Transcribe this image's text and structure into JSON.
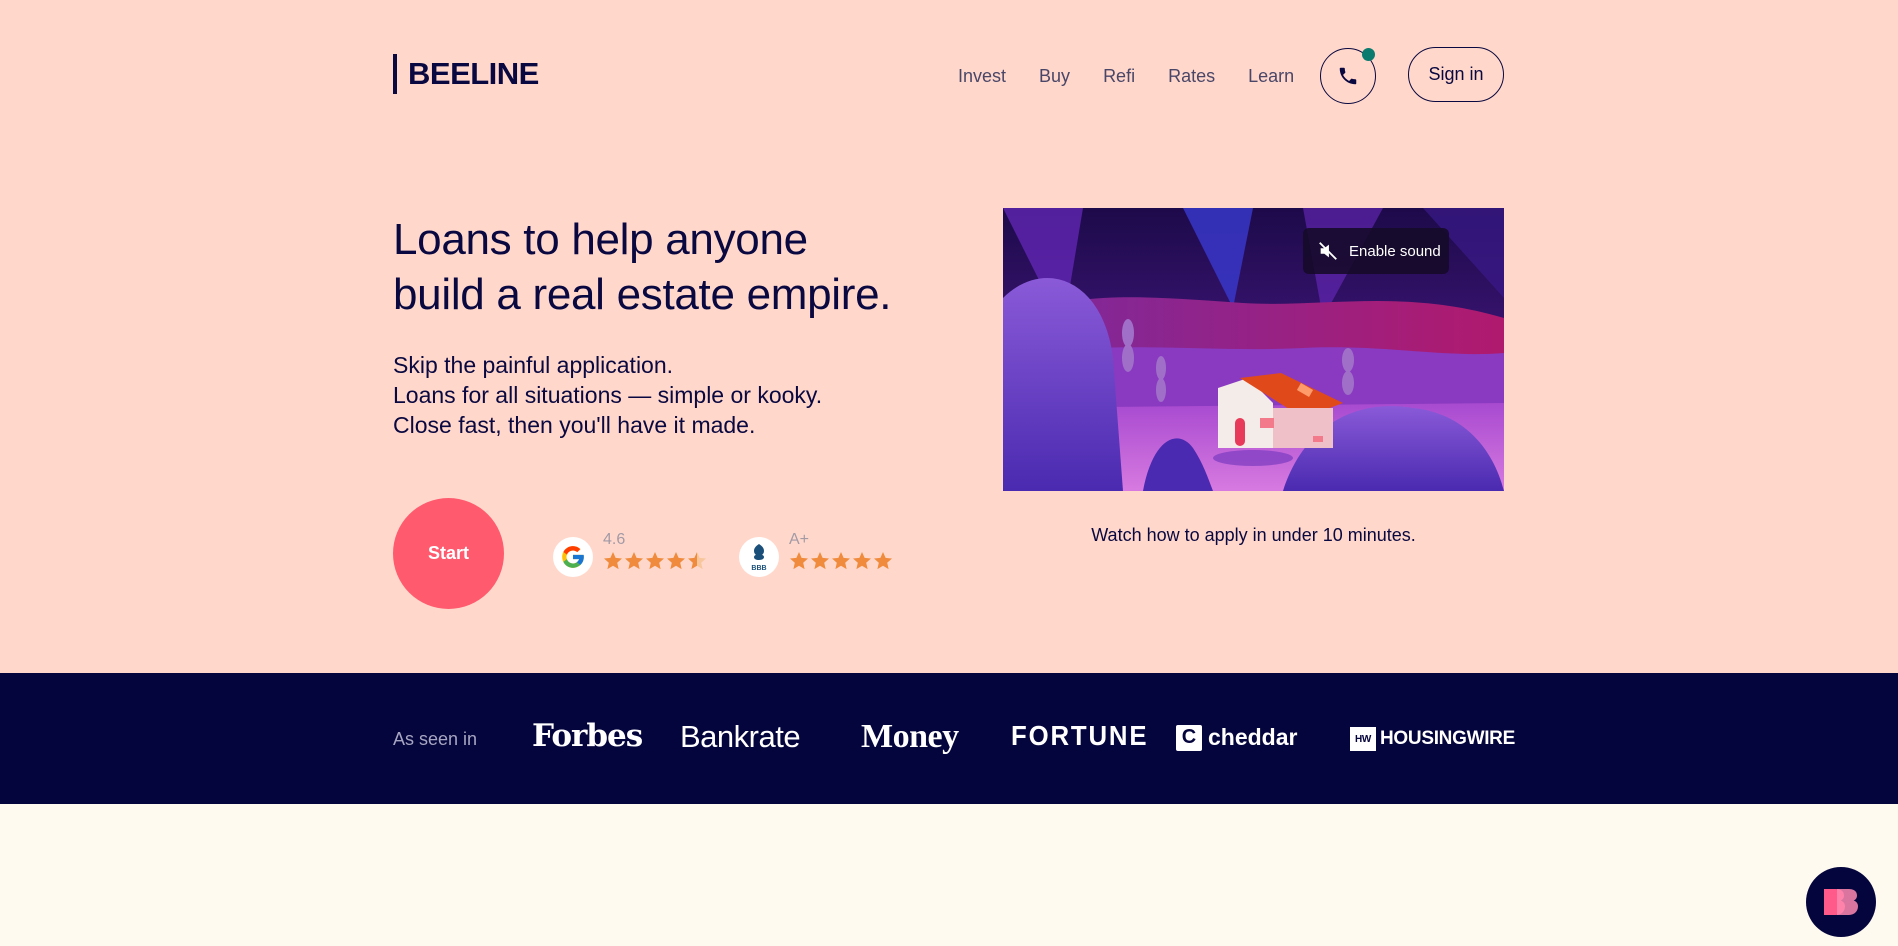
{
  "brand": {
    "name": "BEELINE",
    "colors": {
      "navy": "#0a0840",
      "hero_bg": "#ffd8cb",
      "accent": "#ff5a6e",
      "star": "#f08a3c",
      "teal": "#0b7b70",
      "press_bg": "#05053d",
      "page_bg": "#fffaef"
    }
  },
  "nav": {
    "items": [
      {
        "label": "Invest"
      },
      {
        "label": "Buy"
      },
      {
        "label": "Refi"
      },
      {
        "label": "Rates"
      },
      {
        "label": "Learn"
      }
    ],
    "phone_icon": "phone-icon",
    "signin_label": "Sign in"
  },
  "hero": {
    "headline_line1": "Loans to help anyone",
    "headline_line2": "build a real estate empire.",
    "sub_line1": "Skip the painful application.",
    "sub_line2": "Loans for all situations — simple or kooky.",
    "sub_line3": "Close fast, then you'll have it made.",
    "start_label": "Start",
    "ratings": [
      {
        "source": "google-icon",
        "score": "4.6",
        "stars": 4.5
      },
      {
        "source": "bbb-icon",
        "score": "A+",
        "stars": 5
      }
    ]
  },
  "video": {
    "sound_label": "Enable sound",
    "sound_icon": "muted-speaker-icon",
    "caption": "Watch how to apply in under 10 minutes."
  },
  "press": {
    "label": "As seen in",
    "logos": [
      "Forbes",
      "Bankrate",
      "Money",
      "FORTUNE",
      "cheddar",
      "HOUSINGWIRE"
    ],
    "cheddar_mark": "C",
    "housingwire_mark": "HW"
  },
  "chat": {
    "icon": "beeline-chat-icon"
  }
}
